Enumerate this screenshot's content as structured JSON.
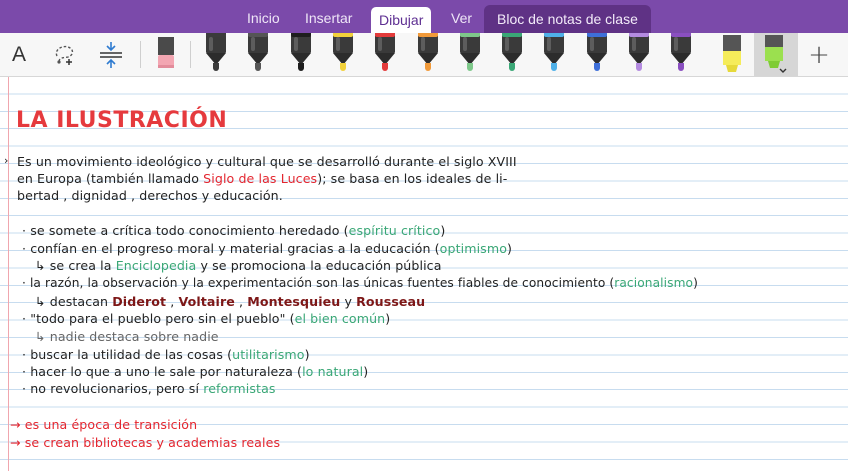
{
  "tabs": [
    {
      "label": "Inicio"
    },
    {
      "label": "Insertar"
    },
    {
      "label": "Dibujar"
    },
    {
      "label": "Ver"
    },
    {
      "label": "Bloc de notas de clase"
    }
  ],
  "toolbar": {
    "text_tool_icon": "A",
    "lasso_icon": "lasso-select-icon",
    "space_icon": "insert-space-icon",
    "eraser_icon": "eraser-icon",
    "add_icon": "+",
    "pens": [
      {
        "color": "#3b3b3b"
      },
      {
        "color": "#555555"
      },
      {
        "color": "#1e1e1e"
      },
      {
        "color": "#f2d13a"
      },
      {
        "color": "#e33b3b"
      },
      {
        "color": "#f19a3a"
      },
      {
        "color": "#7ec88a"
      },
      {
        "color": "#3aa776"
      },
      {
        "color": "#4fb0e8"
      },
      {
        "color": "#3e6fd8"
      },
      {
        "color": "#b48be0"
      },
      {
        "color": "#8a4fc0"
      }
    ],
    "highlighters": [
      {
        "color": "#f5ec5a"
      },
      {
        "color": "#9be04f"
      }
    ]
  },
  "note": {
    "title": "LA ILUSTRACIÓN",
    "intro": {
      "l1": "Es un movimiento ideológico y cultural que se desarrolló durante el siglo XVIII",
      "l2a": "en Europa (también llamado ",
      "l2b": "Siglo de las Luces",
      "l2c": "); se basa en los ideales de li-",
      "l3": "bertad , dignidad , derechos y educación."
    },
    "b1a": "· se somete a crítica todo conocimiento heredado (",
    "b1b": "espíritu crítico",
    "b1c": ")",
    "b2a": "· confían en el progreso moral y material gracias a la educación (",
    "b2b": "optimismo",
    "b2c": ")",
    "s1a": "↳ se crea la ",
    "s1b": "Enciclopedia",
    "s1c": " y se promociona la educación pública",
    "b3a": "· la razón, la observación y la experimentación son las únicas fuentes fiables de conocimiento (",
    "b3b": "racionalismo",
    "b3c": ")",
    "s2a": "↳ destacan ",
    "s2b": "Diderot",
    "s2c": " , ",
    "s2d": "Voltaire",
    "s2e": " , ",
    "s2f": "Montesquieu",
    "s2g": " y ",
    "s2h": "Rousseau",
    "b4a": "· \"todo para el pueblo pero sin el pueblo\" (",
    "b4b": "el bien común",
    "b4c": ")",
    "s3": "↳ nadie destaca sobre nadie",
    "b5a": "· buscar la utilidad de las cosas (",
    "b5b": "utilitarismo",
    "b5c": ")",
    "b6a": "· hacer lo que a uno le sale por naturaleza (",
    "b6b": "lo natural",
    "b6c": ")",
    "b7a": "· no revolucionarios, pero sí ",
    "b7b": "reformistas",
    "c1": "→ es una época de transición",
    "c2": "→ se crean bibliotecas y academias reales"
  }
}
